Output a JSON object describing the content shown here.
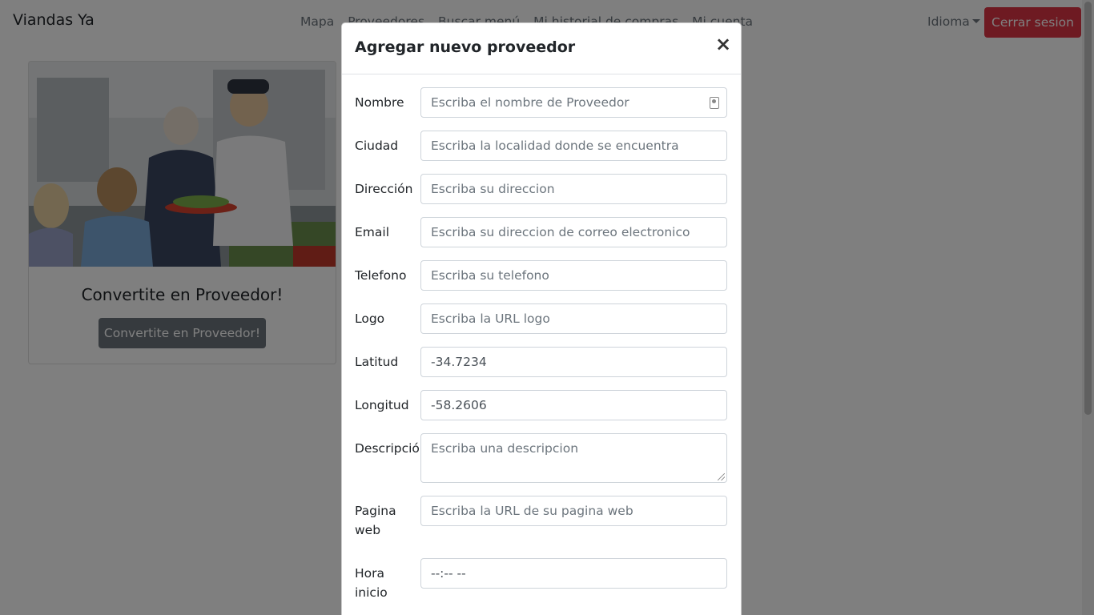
{
  "nav": {
    "brand": "Viandas Ya",
    "links": [
      "Mapa",
      "Proveedores",
      "Buscar menú",
      "Mi historial de compras",
      "Mi cuenta"
    ],
    "language": "Idioma",
    "logout": "Cerrar sesion"
  },
  "card": {
    "title": "Convertite en Proveedor!",
    "button": "Convertite en Proveedor!"
  },
  "modal": {
    "title": "Agregar nuevo proveedor",
    "close": "×",
    "fields": [
      {
        "label": "Nombre",
        "placeholder": "Escriba el nombre de Proveedor",
        "value": ""
      },
      {
        "label": "Ciudad",
        "placeholder": "Escriba la localidad donde se encuentra",
        "value": ""
      },
      {
        "label": "Dirección",
        "placeholder": "Escriba su direccion",
        "value": ""
      },
      {
        "label": "Email",
        "placeholder": "Escriba su direccion de correo electronico",
        "value": ""
      },
      {
        "label": "Telefono",
        "placeholder": "Escriba su telefono",
        "value": ""
      },
      {
        "label": "Logo",
        "placeholder": "Escriba la URL logo",
        "value": ""
      },
      {
        "label": "Latitud",
        "placeholder": "",
        "value": "-34.7234"
      },
      {
        "label": "Longitud",
        "placeholder": "",
        "value": "-58.2606"
      },
      {
        "label": "Descripción",
        "placeholder": "Escriba una descripcion",
        "value": ""
      },
      {
        "label": "Pagina web",
        "placeholder": "Escriba la URL de su pagina web",
        "value": ""
      },
      {
        "label": "Hora inicio",
        "placeholder": "",
        "value": "--:-- --"
      }
    ]
  },
  "colors": {
    "danger": "#dc3545",
    "secondary": "#6c757d",
    "backdrop": "rgba(0,0,0,0.5)"
  },
  "icons": [
    "contact-card-icon",
    "close-icon",
    "chevron-down-icon"
  ]
}
